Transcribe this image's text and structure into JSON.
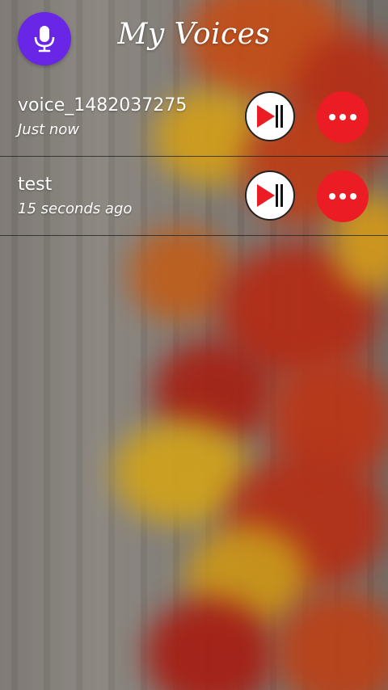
{
  "header": {
    "title": "My Voices",
    "record_icon": "microphone-icon",
    "record_color": "#6a26e6"
  },
  "recordings": [
    {
      "name": "voice_1482037275",
      "time": "Just now"
    },
    {
      "name": "test",
      "time": "15 seconds ago"
    }
  ],
  "controls": {
    "play_pause_icon": "play-pause-icon",
    "more_icon": "more-options-icon",
    "play_color": "#ec1c24",
    "more_color": "#ec1c24"
  }
}
